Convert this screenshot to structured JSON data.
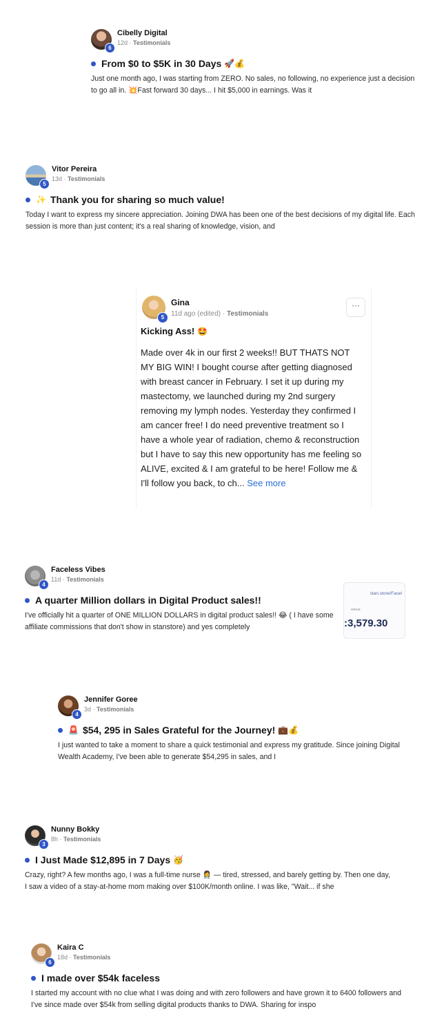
{
  "posts": [
    {
      "author": "Cibelly Digital",
      "level": "6",
      "time": "12d",
      "category": "Testimonials",
      "title": "From $0 to $5K in 30 Days",
      "title_emoji": "🚀💰",
      "body": "Just one month ago, I was starting from ZERO. No sales, no following, no experience just a decision to go all in. 💥Fast forward 30 days... I hit $5,000 in earnings. Was it"
    },
    {
      "author": "Vitor Pereira",
      "level": "5",
      "time": "13d",
      "category": "Testimonials",
      "title_prefix": "✨",
      "title": "Thank you for sharing so much value!",
      "body": "Today I want to express my sincere appreciation. Joining DWA has been one of the best decisions of my digital life. Each session is more than just content; it's a real sharing of knowledge, vision, and"
    },
    {
      "author": "Gina",
      "level": "5",
      "time": "11d ago (edited)",
      "category": "Testimonials",
      "more": "···",
      "title": "Kicking Ass!",
      "title_emoji": "🤩",
      "body": "Made over 4k in our first 2 weeks!! BUT THATS NOT MY BIG WIN! I bought course after getting diagnosed with breast cancer in February. I set it up during my mastectomy, we launched during my 2nd surgery removing my lymph nodes. Yesterday they confirmed I am cancer free! I do need preventive treatment so I have a whole year of radiation, chemo & reconstruction but I have to say this new opportunity has me feeling so ALIVE, excited & I am grateful to be here! Follow me & I'll follow you back, to ch...",
      "see_more": "See more"
    },
    {
      "author": "Faceless Vibes",
      "level": "4",
      "time": "11d",
      "category": "Testimonials",
      "title": "A quarter Million dollars in Digital Product sales!!",
      "body": "I've officially hit a quarter of ONE MILLION DOLLARS in digital product sales!! 😂 ( I have some affiliate commissions that don't show in stanstore) and yes completely",
      "thumb_url": "stan.store/Facel",
      "thumb_label": "venue",
      "thumb_value": ":3,579.30"
    },
    {
      "author": "Jennifer Goree",
      "level": "4",
      "time": "3d",
      "category": "Testimonials",
      "title_prefix": "🚨",
      "title": "$54, 295 in Sales Grateful for the Journey!",
      "title_emoji": "💼💰",
      "body": "I just wanted to take a moment to share a quick testimonial and express my gratitude. Since joining Digital Wealth Academy, I've been able to generate $54,295 in sales, and I"
    },
    {
      "author": "Nunny Bokky",
      "level": "3",
      "time": "8h",
      "category": "Testimonials",
      "title": "I Just Made $12,895 in 7 Days",
      "title_emoji": "🥳",
      "body": "Crazy, right? A few months ago, I was a full-time nurse 👩‍⚕️ — tired, stressed, and barely getting by. Then one day, I saw a video of a stay-at-home mom making over $100K/month online. I was like, \"Wait... if she"
    },
    {
      "author": "Kaira C",
      "level": "6",
      "time": "18d",
      "category": "Testimonials",
      "title": "I made over $54k faceless",
      "body": "I started my account with no clue what I was doing and with zero followers and have grown it to 6400 followers and I've since made over $54k from selling digital products thanks to DWA. Sharing for inspo"
    }
  ],
  "sep": " · "
}
